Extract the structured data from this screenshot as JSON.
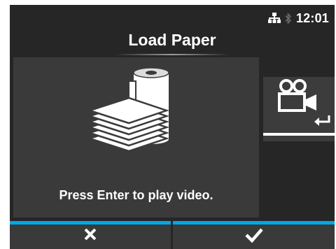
{
  "status": {
    "time": "12:01",
    "icons": [
      "network-icon",
      "bluetooth-icon"
    ]
  },
  "screen": {
    "title": "Load Paper"
  },
  "main": {
    "caption": "Press Enter to play video.",
    "illustration_icon": "paper-roll-and-stack-icon"
  },
  "side_button": {
    "icons": [
      "video-camera-icon",
      "enter-icon"
    ]
  },
  "bottom_bar": {
    "cancel": {
      "icon": "close-icon"
    },
    "confirm": {
      "icon": "checkmark-icon"
    }
  },
  "colors": {
    "background": "#262626",
    "panel": "#3a3a3a",
    "accent": "#00a8e6",
    "text": "#ffffff"
  }
}
